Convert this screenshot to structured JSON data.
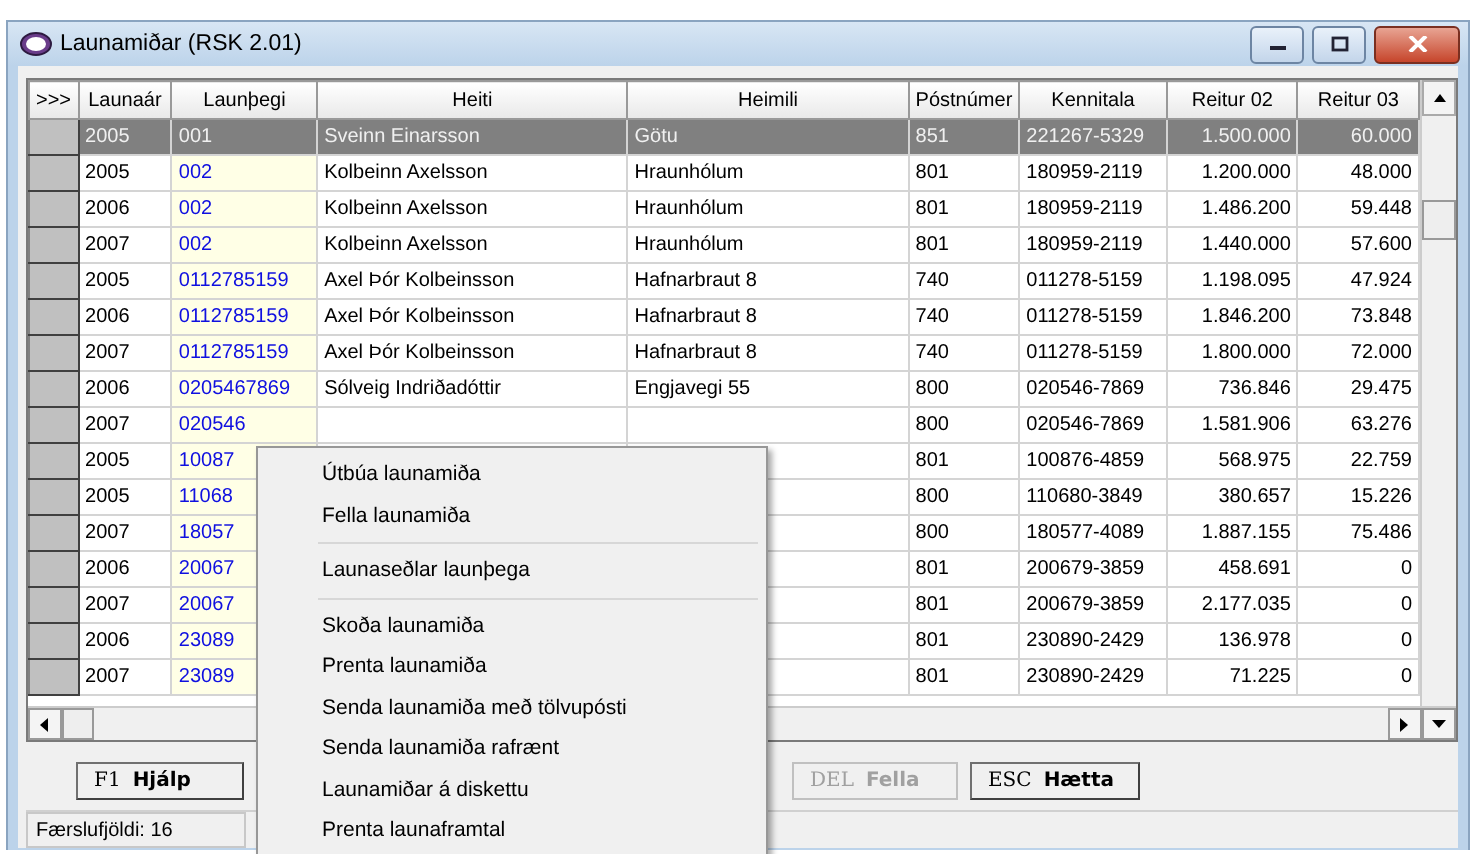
{
  "window": {
    "title": "Launamiðar (RSK 2.01)"
  },
  "table": {
    "corner": ">>>",
    "columns": [
      "Launaár",
      "Launþegi",
      "Heiti",
      "Heimili",
      "Póstnúmer",
      "Kennitala",
      "Reitur 02",
      "Reitur 03"
    ],
    "rows": [
      {
        "selected": true,
        "cells": [
          "2005",
          "001",
          "Sveinn Einarsson",
          "Götu",
          "851",
          "221267-5329",
          "1.500.000",
          "60.000"
        ]
      },
      {
        "selected": false,
        "cells": [
          "2005",
          "002",
          "Kolbeinn Axelsson",
          "Hraunhólum",
          "801",
          "180959-2119",
          "1.200.000",
          "48.000"
        ]
      },
      {
        "selected": false,
        "cells": [
          "2006",
          "002",
          "Kolbeinn Axelsson",
          "Hraunhólum",
          "801",
          "180959-2119",
          "1.486.200",
          "59.448"
        ]
      },
      {
        "selected": false,
        "cells": [
          "2007",
          "002",
          "Kolbeinn Axelsson",
          "Hraunhólum",
          "801",
          "180959-2119",
          "1.440.000",
          "57.600"
        ]
      },
      {
        "selected": false,
        "cells": [
          "2005",
          "0112785159",
          "Axel Þór Kolbeinsson",
          "Hafnarbraut 8",
          "740",
          "011278-5159",
          "1.198.095",
          "47.924"
        ]
      },
      {
        "selected": false,
        "cells": [
          "2006",
          "0112785159",
          "Axel Þór Kolbeinsson",
          "Hafnarbraut 8",
          "740",
          "011278-5159",
          "1.846.200",
          "73.848"
        ]
      },
      {
        "selected": false,
        "cells": [
          "2007",
          "0112785159",
          "Axel Þór Kolbeinsson",
          "Hafnarbraut 8",
          "740",
          "011278-5159",
          "1.800.000",
          "72.000"
        ]
      },
      {
        "selected": false,
        "cells": [
          "2006",
          "0205467869",
          "Sólveig Indriðadóttir",
          "Engjavegi 55",
          "800",
          "020546-7869",
          "736.846",
          "29.475"
        ]
      },
      {
        "selected": false,
        "cells": [
          "2007",
          "020546",
          null,
          null,
          "800",
          "020546-7869",
          "1.581.906",
          "63.276"
        ]
      },
      {
        "selected": false,
        "cells": [
          "2005",
          "10087",
          null,
          null,
          "801",
          "100876-4859",
          "568.975",
          "22.759"
        ]
      },
      {
        "selected": false,
        "cells": [
          "2005",
          "11068",
          null,
          null,
          "800",
          "110680-3849",
          "380.657",
          "15.226"
        ]
      },
      {
        "selected": false,
        "cells": [
          "2007",
          "18057",
          null,
          null,
          "800",
          "180577-4089",
          "1.887.155",
          "75.486"
        ]
      },
      {
        "selected": false,
        "cells": [
          "2006",
          "20067",
          null,
          null,
          "801",
          "200679-3859",
          "458.691",
          "0"
        ]
      },
      {
        "selected": false,
        "cells": [
          "2007",
          "20067",
          null,
          null,
          "801",
          "200679-3859",
          "2.177.035",
          "0"
        ]
      },
      {
        "selected": false,
        "cells": [
          "2006",
          "23089",
          null,
          null,
          "801",
          "230890-2429",
          "136.978",
          "0"
        ]
      },
      {
        "selected": false,
        "cells": [
          "2007",
          "23089",
          null,
          null,
          "801",
          "230890-2429",
          "71.225",
          "0"
        ]
      }
    ]
  },
  "buttons": [
    {
      "key": "F1",
      "label": "Hjálp",
      "disabled": false
    },
    {
      "key": "DEL",
      "label": "Fella",
      "disabled": true
    },
    {
      "key": "ESC",
      "label": "Hætta",
      "disabled": false
    }
  ],
  "status_bar": {
    "text": "Færslufjöldi: 16"
  },
  "context_menu": {
    "items": [
      {
        "kind": "item",
        "label": "Útbúa launamiða"
      },
      {
        "kind": "item",
        "label": "Fella launamiða"
      },
      {
        "kind": "separator"
      },
      {
        "kind": "item",
        "label": "Launaseðlar launþega"
      },
      {
        "kind": "separator"
      },
      {
        "kind": "item",
        "label": "Skoða launamiða"
      },
      {
        "kind": "item",
        "label": "Prenta launamiða"
      },
      {
        "kind": "item",
        "label": "Senda launamiða með tölvupósti"
      },
      {
        "kind": "item",
        "label": "Senda launamiða rafrænt"
      },
      {
        "kind": "item",
        "label": "Launamiðar á diskettu"
      },
      {
        "kind": "item",
        "label": "Prenta launaframtal"
      }
    ]
  }
}
